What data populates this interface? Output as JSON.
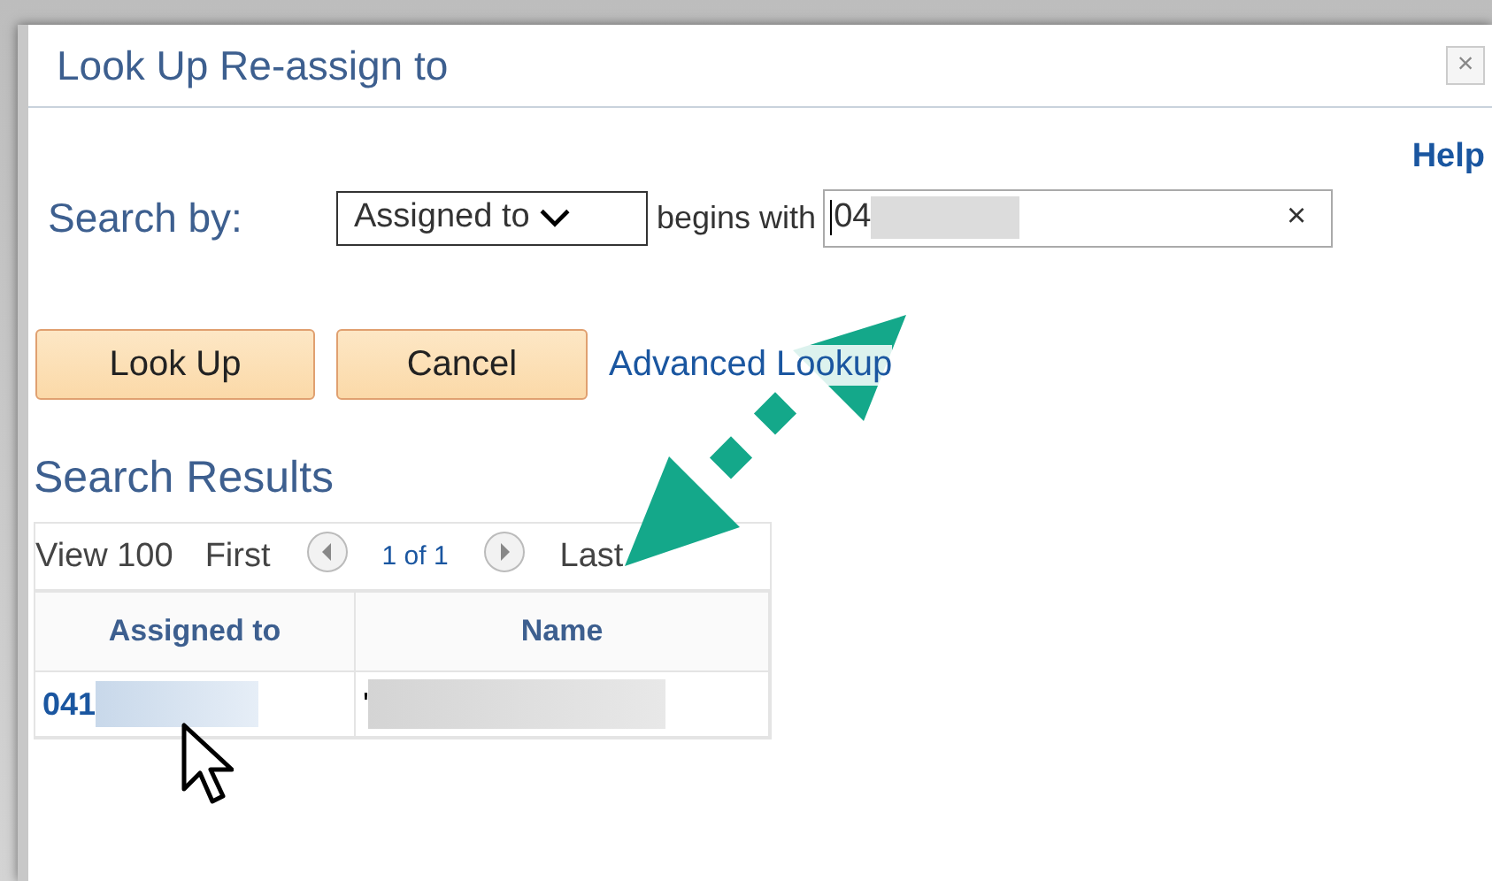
{
  "window": {
    "title": "Look Up Re-assign to",
    "close": "×"
  },
  "help": "Help",
  "search": {
    "label": "Search by:",
    "field_select": "Assigned to",
    "operator": "begins with",
    "value": "04",
    "redacted": true,
    "clear": "×"
  },
  "buttons": [
    "Look Up",
    "Cancel"
  ],
  "advanced_link": "Advanced Lookup",
  "results": {
    "title": "Search Results",
    "nav": {
      "view": "View 100",
      "first": "First",
      "page": "1 of 1",
      "last": "Last"
    },
    "columns": [
      "Assigned to",
      "Name"
    ],
    "rows": [
      {
        "cells": [
          {
            "text": "041",
            "link": true,
            "redacted": true
          },
          {
            "text": "'",
            "link": false,
            "redacted": true
          }
        ]
      }
    ]
  }
}
